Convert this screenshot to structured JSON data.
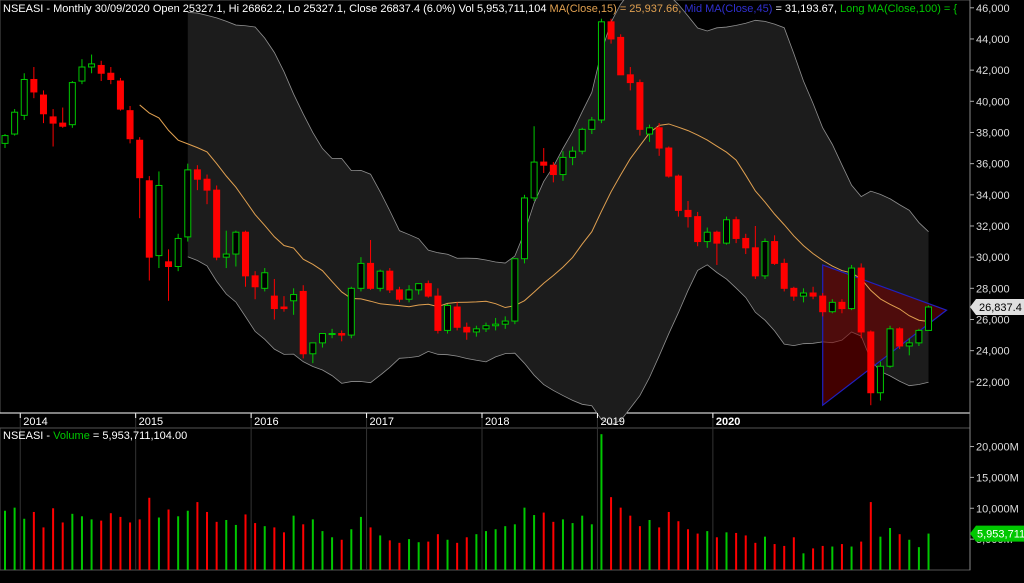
{
  "header": {
    "symbol": "NSEASI",
    "summary": " - Monthly 30/09/2020 Open 25327.1, Hi 26862.2, Lo 25327.1, Close 26837.4 (6.0%) Vol 5,953,711,104 ",
    "ma15": "MA(Close,15) = 25,937.66, ",
    "ma45": "Mid MA(Close,45)",
    "ma45_value": " = 31,193.67, ",
    "ma100": "Long MA(Close,100) = {"
  },
  "volume_header": {
    "symbol": "NSEASI",
    "sep": " - ",
    "label": "Volume",
    "value": " = 5,953,711,104.00"
  },
  "colors": {
    "background": "#000000",
    "up": "#00c800",
    "down": "#ff0000",
    "ma15": "#e0a050",
    "ma45": "#0000c8",
    "ma100": "#00c800",
    "band": "#909090",
    "last_price_bg": "#e0e0e0",
    "last_volume_bg": "#00c800"
  },
  "chart_data": {
    "type": "candlestick",
    "price_axis": {
      "ylim": [
        20000,
        46500
      ],
      "ticks": [
        22000,
        24000,
        26000,
        28000,
        30000,
        32000,
        34000,
        36000,
        38000,
        40000,
        42000,
        44000,
        46000
      ],
      "tick_labels": [
        "22,000",
        "24,000",
        "26,000",
        "28,000",
        "30,000",
        "32,000",
        "34,000",
        "36,000",
        "38,000",
        "40,000",
        "42,000",
        "44,000",
        "46,000"
      ]
    },
    "volume_axis": {
      "ylim": [
        0,
        23000
      ],
      "ticks": [
        5000,
        10000,
        15000,
        20000
      ],
      "tick_labels": [
        "5,000M",
        "10,000M",
        "15,000M",
        "20,000M"
      ]
    },
    "x_labels": [
      {
        "label": "2014",
        "index": 2
      },
      {
        "label": "2015",
        "index": 14
      },
      {
        "label": "2016",
        "index": 26
      },
      {
        "label": "2017",
        "index": 38
      },
      {
        "label": "2018",
        "index": 50
      },
      {
        "label": "2019",
        "index": 62
      },
      {
        "label": "2020",
        "index": 74
      }
    ],
    "last_price_label": "26,837.4",
    "last_volume_label": "5,953,711",
    "candles": [
      {
        "o": 37300,
        "h": 37900,
        "l": 37000,
        "c": 37800,
        "v": 9600
      },
      {
        "o": 37900,
        "h": 39500,
        "l": 37800,
        "c": 39300,
        "v": 10100
      },
      {
        "o": 39100,
        "h": 41800,
        "l": 38800,
        "c": 41400,
        "v": 8300
      },
      {
        "o": 41400,
        "h": 42200,
        "l": 40200,
        "c": 40600,
        "v": 9400
      },
      {
        "o": 40400,
        "h": 40700,
        "l": 38600,
        "c": 39200,
        "v": 6900
      },
      {
        "o": 39000,
        "h": 39500,
        "l": 37100,
        "c": 38600,
        "v": 10000
      },
      {
        "o": 38600,
        "h": 39600,
        "l": 38300,
        "c": 38400,
        "v": 7700
      },
      {
        "o": 38500,
        "h": 41300,
        "l": 38300,
        "c": 41200,
        "v": 9100
      },
      {
        "o": 41300,
        "h": 42700,
        "l": 41100,
        "c": 42200,
        "v": 8700
      },
      {
        "o": 42200,
        "h": 43000,
        "l": 41800,
        "c": 42400,
        "v": 8200
      },
      {
        "o": 42300,
        "h": 42600,
        "l": 41300,
        "c": 41800,
        "v": 8000
      },
      {
        "o": 41800,
        "h": 42200,
        "l": 41100,
        "c": 41400,
        "v": 9200
      },
      {
        "o": 41300,
        "h": 41500,
        "l": 39400,
        "c": 39500,
        "v": 8600
      },
      {
        "o": 39400,
        "h": 39700,
        "l": 37300,
        "c": 37600,
        "v": 7700
      },
      {
        "o": 37500,
        "h": 37700,
        "l": 32500,
        "c": 35100,
        "v": 8200
      },
      {
        "o": 34900,
        "h": 35200,
        "l": 28500,
        "c": 30000,
        "v": 11700
      },
      {
        "o": 30100,
        "h": 35500,
        "l": 29300,
        "c": 34600,
        "v": 8500
      },
      {
        "o": 29700,
        "h": 30500,
        "l": 27200,
        "c": 29400,
        "v": 9800
      },
      {
        "o": 29400,
        "h": 31500,
        "l": 29100,
        "c": 31200,
        "v": 8700
      },
      {
        "o": 31300,
        "h": 36000,
        "l": 31000,
        "c": 35600,
        "v": 9600
      },
      {
        "o": 35600,
        "h": 35900,
        "l": 34300,
        "c": 35000,
        "v": 11000
      },
      {
        "o": 35000,
        "h": 35300,
        "l": 33400,
        "c": 34300,
        "v": 9400
      },
      {
        "o": 34300,
        "h": 34600,
        "l": 29800,
        "c": 30000,
        "v": 7800
      },
      {
        "o": 30000,
        "h": 31700,
        "l": 29300,
        "c": 30200,
        "v": 8100
      },
      {
        "o": 30200,
        "h": 31700,
        "l": 29400,
        "c": 31600,
        "v": 7300
      },
      {
        "o": 31600,
        "h": 31700,
        "l": 28100,
        "c": 28800,
        "v": 9000
      },
      {
        "o": 28800,
        "h": 29100,
        "l": 27300,
        "c": 28100,
        "v": 7600
      },
      {
        "o": 28000,
        "h": 29300,
        "l": 27800,
        "c": 29000,
        "v": 7100
      },
      {
        "o": 27500,
        "h": 28600,
        "l": 26000,
        "c": 26700,
        "v": 6900
      },
      {
        "o": 26800,
        "h": 27500,
        "l": 26500,
        "c": 26700,
        "v": 6100
      },
      {
        "o": 27200,
        "h": 28000,
        "l": 26300,
        "c": 27600,
        "v": 8800
      },
      {
        "o": 27800,
        "h": 28200,
        "l": 23500,
        "c": 23800,
        "v": 7400
      },
      {
        "o": 23800,
        "h": 24500,
        "l": 23200,
        "c": 24500,
        "v": 8200
      },
      {
        "o": 24500,
        "h": 25100,
        "l": 24200,
        "c": 25100,
        "v": 6300
      },
      {
        "o": 25100,
        "h": 25400,
        "l": 24800,
        "c": 25100,
        "v": 5300
      },
      {
        "o": 25100,
        "h": 25300,
        "l": 24600,
        "c": 25000,
        "v": 4900
      },
      {
        "o": 25000,
        "h": 28100,
        "l": 24800,
        "c": 28000,
        "v": 6600
      },
      {
        "o": 28000,
        "h": 30000,
        "l": 27800,
        "c": 29600,
        "v": 8600
      },
      {
        "o": 29600,
        "h": 31100,
        "l": 27900,
        "c": 28000,
        "v": 6900
      },
      {
        "o": 28000,
        "h": 29200,
        "l": 27800,
        "c": 29100,
        "v": 5600
      },
      {
        "o": 29100,
        "h": 29300,
        "l": 27700,
        "c": 27900,
        "v": 4800
      },
      {
        "o": 27900,
        "h": 28100,
        "l": 27100,
        "c": 27300,
        "v": 4400
      },
      {
        "o": 27300,
        "h": 28200,
        "l": 27100,
        "c": 27900,
        "v": 5000
      },
      {
        "o": 27900,
        "h": 28300,
        "l": 27600,
        "c": 28300,
        "v": 4500
      },
      {
        "o": 28300,
        "h": 28500,
        "l": 27400,
        "c": 27500,
        "v": 4600
      },
      {
        "o": 27500,
        "h": 28000,
        "l": 25100,
        "c": 25300,
        "v": 5800
      },
      {
        "o": 25300,
        "h": 27000,
        "l": 25100,
        "c": 26900,
        "v": 4900
      },
      {
        "o": 26800,
        "h": 27100,
        "l": 25300,
        "c": 25500,
        "v": 4400
      },
      {
        "o": 25500,
        "h": 25800,
        "l": 24700,
        "c": 25200,
        "v": 5300
      },
      {
        "o": 25200,
        "h": 25600,
        "l": 24900,
        "c": 25400,
        "v": 5800
      },
      {
        "o": 25400,
        "h": 25800,
        "l": 25200,
        "c": 25600,
        "v": 6300
      },
      {
        "o": 25600,
        "h": 26100,
        "l": 25300,
        "c": 25700,
        "v": 6600
      },
      {
        "o": 25700,
        "h": 26200,
        "l": 25400,
        "c": 25900,
        "v": 7100
      },
      {
        "o": 25900,
        "h": 29900,
        "l": 25700,
        "c": 29900,
        "v": 7400
      },
      {
        "o": 29900,
        "h": 34000,
        "l": 29600,
        "c": 33800,
        "v": 10100
      },
      {
        "o": 33800,
        "h": 38400,
        "l": 33600,
        "c": 36100,
        "v": 8900
      },
      {
        "o": 36100,
        "h": 37000,
        "l": 35400,
        "c": 35900,
        "v": 9300
      },
      {
        "o": 35900,
        "h": 36100,
        "l": 34800,
        "c": 35300,
        "v": 7800
      },
      {
        "o": 35300,
        "h": 36800,
        "l": 34900,
        "c": 36400,
        "v": 8200
      },
      {
        "o": 36400,
        "h": 37100,
        "l": 35900,
        "c": 36800,
        "v": 7600
      },
      {
        "o": 36800,
        "h": 38300,
        "l": 36600,
        "c": 38200,
        "v": 8800
      },
      {
        "o": 38200,
        "h": 39000,
        "l": 37900,
        "c": 38800,
        "v": 7400
      },
      {
        "o": 38800,
        "h": 45300,
        "l": 38600,
        "c": 45100,
        "v": 22000
      },
      {
        "o": 45100,
        "h": 45300,
        "l": 43700,
        "c": 44000,
        "v": 11800
      },
      {
        "o": 44100,
        "h": 44300,
        "l": 41900,
        "c": 41700,
        "v": 10100
      },
      {
        "o": 41700,
        "h": 42200,
        "l": 40700,
        "c": 41200,
        "v": 8800
      },
      {
        "o": 41200,
        "h": 41400,
        "l": 37800,
        "c": 38200,
        "v": 7100
      },
      {
        "o": 37900,
        "h": 38500,
        "l": 37400,
        "c": 38300,
        "v": 8100
      },
      {
        "o": 38300,
        "h": 38600,
        "l": 36500,
        "c": 37000,
        "v": 6900
      },
      {
        "o": 37000,
        "h": 37100,
        "l": 35100,
        "c": 35200,
        "v": 9400
      },
      {
        "o": 35200,
        "h": 35300,
        "l": 32600,
        "c": 33000,
        "v": 7900
      },
      {
        "o": 33000,
        "h": 33600,
        "l": 31900,
        "c": 32600,
        "v": 6600
      },
      {
        "o": 32600,
        "h": 32900,
        "l": 30700,
        "c": 31000,
        "v": 5900
      },
      {
        "o": 31000,
        "h": 31900,
        "l": 30600,
        "c": 31600,
        "v": 6300
      },
      {
        "o": 31600,
        "h": 31700,
        "l": 29500,
        "c": 30900,
        "v": 5300
      },
      {
        "o": 30900,
        "h": 32600,
        "l": 30800,
        "c": 32400,
        "v": 6100
      },
      {
        "o": 32400,
        "h": 32600,
        "l": 30900,
        "c": 31200,
        "v": 6000
      },
      {
        "o": 31200,
        "h": 31500,
        "l": 30200,
        "c": 30600,
        "v": 5600
      },
      {
        "o": 30600,
        "h": 32000,
        "l": 28600,
        "c": 28800,
        "v": 4400
      },
      {
        "o": 28800,
        "h": 31200,
        "l": 28600,
        "c": 31000,
        "v": 5400
      },
      {
        "o": 31000,
        "h": 31400,
        "l": 29500,
        "c": 29600,
        "v": 4200
      },
      {
        "o": 29600,
        "h": 29900,
        "l": 27800,
        "c": 28000,
        "v": 3900
      },
      {
        "o": 28000,
        "h": 28100,
        "l": 27200,
        "c": 27500,
        "v": 5300
      },
      {
        "o": 27500,
        "h": 28000,
        "l": 27100,
        "c": 27700,
        "v": 2700
      },
      {
        "o": 27700,
        "h": 28100,
        "l": 27300,
        "c": 27500,
        "v": 3500
      },
      {
        "o": 27500,
        "h": 27700,
        "l": 26200,
        "c": 26500,
        "v": 3900
      },
      {
        "o": 26500,
        "h": 27300,
        "l": 26400,
        "c": 27100,
        "v": 3800
      },
      {
        "o": 27100,
        "h": 27300,
        "l": 26400,
        "c": 26700,
        "v": 4200
      },
      {
        "o": 26700,
        "h": 29500,
        "l": 26600,
        "c": 29300,
        "v": 3800
      },
      {
        "o": 29300,
        "h": 29600,
        "l": 24800,
        "c": 25200,
        "v": 4600
      },
      {
        "o": 25200,
        "h": 25300,
        "l": 20500,
        "c": 21300,
        "v": 11000
      },
      {
        "o": 21300,
        "h": 23300,
        "l": 20800,
        "c": 23000,
        "v": 5400
      },
      {
        "o": 23000,
        "h": 25600,
        "l": 22900,
        "c": 25400,
        "v": 6800
      },
      {
        "o": 25400,
        "h": 25500,
        "l": 24100,
        "c": 24300,
        "v": 5800
      },
      {
        "o": 24300,
        "h": 24800,
        "l": 23700,
        "c": 24500,
        "v": 4900
      },
      {
        "o": 24500,
        "h": 25400,
        "l": 24300,
        "c": 25300,
        "v": 3700
      },
      {
        "o": 25300,
        "h": 26900,
        "l": 25300,
        "c": 26800,
        "v": 5900
      }
    ]
  }
}
